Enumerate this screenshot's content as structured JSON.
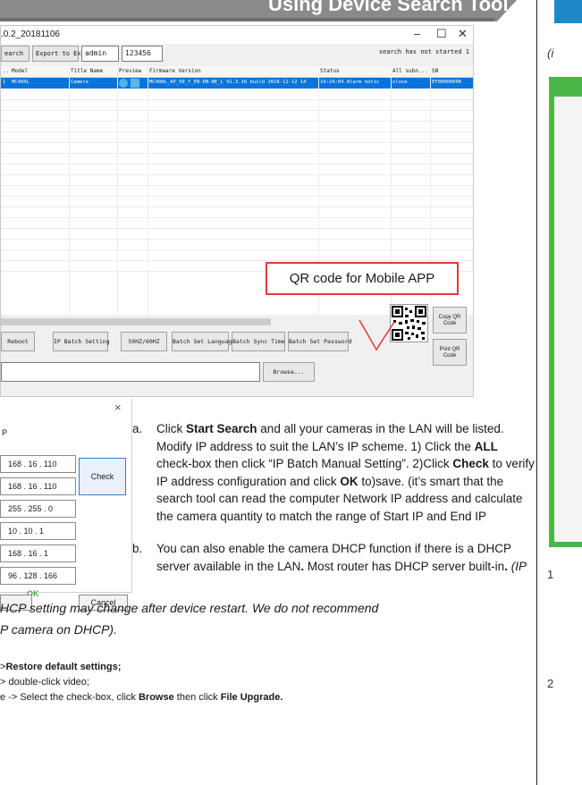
{
  "header": {
    "title": "Using Device Search Tool",
    "banner_color": "#8a8a8a"
  },
  "tool_window": {
    "title": ".0.2_20181106",
    "controls": {
      "minimize": "–",
      "maximize": "☐",
      "close": "✕"
    },
    "toolbar": {
      "search_button": "earch",
      "export_button": "Export to Excel",
      "username": "admin",
      "password": "123456",
      "status": "search has not started 1"
    },
    "columns": [
      "..",
      "Model",
      "Title Name",
      "Preview",
      "Firmware Version",
      "Status",
      "All subn...",
      "SN"
    ],
    "rows": [
      {
        "index": "1",
        "model": "MC400L",
        "title": "Camera",
        "firmware": "MC400L_AP_V0_Y_EN-EN-WE_L V2.3.16 build 2018-12-12 14",
        "status": "14:24:04 Alarm notic",
        "subnet": "close",
        "sn": "EF00000000"
      }
    ],
    "buttons": [
      "Reboot",
      "IP Batch Setting",
      "50HZ/60HZ",
      "Batch Set Language",
      "Batch Sync Time",
      "Batch Set Password"
    ],
    "browse_button": "Browse...",
    "copy_qr": "Copy QR Code",
    "print_qr": "Print QR Code",
    "callout": "QR code for Mobile APP",
    "callout_color": "#e53935",
    "selection_color": "#0a74d8"
  },
  "ip_dialog": {
    "close": "×",
    "label": "P",
    "fields": [
      "168 . 16 . 110",
      "168 . 16 . 110",
      "255 . 255 . 0",
      "10 . 10 . 1",
      "168 . 16 . 1",
      "96 . 128 . 166"
    ],
    "check_button": "Check",
    "ok_label": "OK",
    "cancel_button": "Cancel"
  },
  "instructions": {
    "a": {
      "marker": "a.",
      "parts": [
        "Click ",
        "Start Search",
        " and all your cameras in the LAN will be listed. Modify IP address to suit the LAN’s IP scheme. 1) Click the ",
        "ALL",
        " check-box then click “IP Batch Manual Setting”. 2)Click ",
        "Check",
        " to verify IP address configuration and click ",
        "OK",
        " to)save. (it’s smart that the search tool can read the computer Network IP address and calculate the camera quantity to match the range of Start IP and End IP"
      ]
    },
    "b": {
      "marker": "b.",
      "parts": [
        "You can also enable the camera DHCP function if there is a DHCP server available in the LAN",
        ".",
        " Most router has DHCP server built-in",
        ".",
        " ",
        "(IP"
      ]
    },
    "note_lines": [
      "HCP  setting may change after device restart. We do not recommend",
      "P camera on DHCP)."
    ],
    "steps": [
      {
        "a": ">",
        "b": "Restore default settings;",
        "c": ""
      },
      {
        "a": " > double-click video;",
        "b": "",
        "c": ""
      },
      {
        "a": "e -> Select the check-box, click ",
        "b": "Browse",
        "c": " then click ",
        "d": "File Upgrade."
      }
    ]
  },
  "right_page": {
    "note": "(i",
    "num1": "1",
    "num2": "2",
    "tab_color": "#1e89c8",
    "window_color": "#49b748"
  }
}
